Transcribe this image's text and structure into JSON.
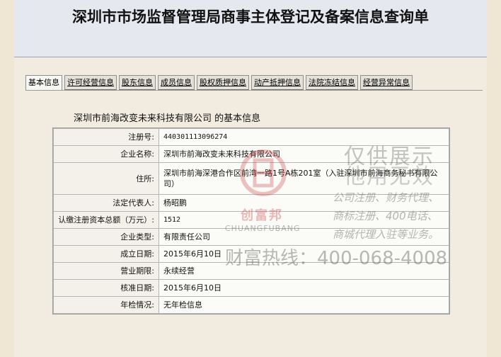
{
  "page_title": "深圳市市场监督管理局商事主体登记及备案信息查询单",
  "tabs": [
    {
      "label": "基本信息",
      "active": true
    },
    {
      "label": "许可经营信息",
      "active": false
    },
    {
      "label": "股东信息",
      "active": false
    },
    {
      "label": "成员信息",
      "active": false
    },
    {
      "label": "股权质押信息",
      "active": false
    },
    {
      "label": "动产抵押信息",
      "active": false
    },
    {
      "label": "法院冻结信息",
      "active": false
    },
    {
      "label": "经营异常信息",
      "active": false
    }
  ],
  "section_title": "深圳市前海改变未来科技有限公司 的基本信息",
  "rows": [
    {
      "label": "注册号:",
      "value": "440301113096274"
    },
    {
      "label": "企业名称:",
      "value": "深圳市前海改变未来科技有限公司"
    },
    {
      "label": "住所:",
      "value": "深圳市前海深港合作区前湾一路1号A栋201室（入驻深圳市前海商务秘书有限公司）"
    },
    {
      "label": "法定代表人:",
      "value": "杨昭鹏"
    },
    {
      "label": "认缴注册资本总额（万元）:",
      "value": "1512"
    },
    {
      "label": "企业类型:",
      "value": "有限责任公司"
    },
    {
      "label": "成立日期:",
      "value": "2015年6月10日"
    },
    {
      "label": "营业期限:",
      "value": "永续经营"
    },
    {
      "label": "核准日期:",
      "value": "2015年6月10日"
    },
    {
      "label": "年检情况:",
      "value": "无年检信息"
    }
  ],
  "watermark": {
    "line1": "仅供展示",
    "line2": "他用无效",
    "services1": "公司注册、财务代理、",
    "services2": "商标注册、400电话、",
    "services3": "商城代理入驻等业务。",
    "hotline": "财富热线：400-068-4008",
    "brand_cn": "创富邦",
    "brand_en": "CHUANGFUBANG"
  },
  "colors": {
    "background": "#f1ecdf",
    "title_bar": "#e6e8ef",
    "watermark_red": "#c83c3c"
  }
}
